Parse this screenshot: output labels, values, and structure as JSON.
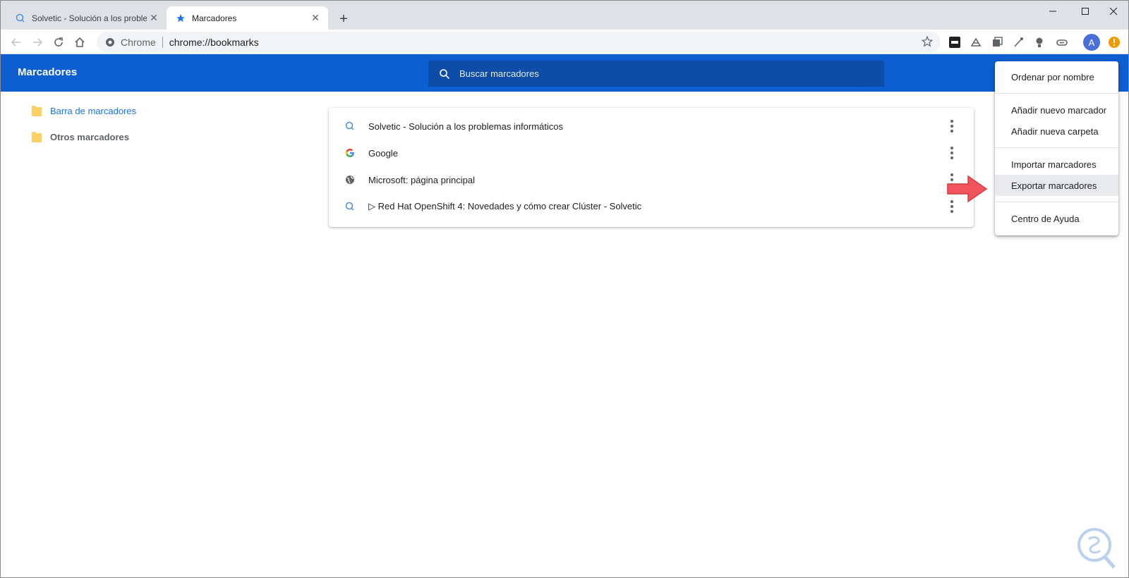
{
  "browser": {
    "tabs": [
      {
        "title": "Solvetic - Solución a los problemas",
        "icon": "solvetic-icon",
        "active": false
      },
      {
        "title": "Marcadores",
        "icon": "star-icon",
        "active": true
      }
    ],
    "new_tab": "+",
    "address": {
      "site_label": "Chrome",
      "url": "chrome://bookmarks"
    },
    "profile_initial": "A"
  },
  "app": {
    "title": "Marcadores",
    "search_placeholder": "Buscar marcadores",
    "accent": "#0d5ed0"
  },
  "sidebar": {
    "items": [
      {
        "label": "Barra de marcadores",
        "selected": true
      },
      {
        "label": "Otros marcadores",
        "selected": false
      }
    ]
  },
  "bookmarks": [
    {
      "title": "Solvetic - Solución a los problemas informáticos",
      "icon": "solvetic-icon"
    },
    {
      "title": "Google",
      "icon": "google-icon"
    },
    {
      "title": "Microsoft: página principal",
      "icon": "globe-icon"
    },
    {
      "title": "▷ Red Hat OpenShift 4: Novedades y cómo crear Clúster - Solvetic",
      "icon": "solvetic-icon"
    }
  ],
  "menu": {
    "items": [
      {
        "label": "Ordenar por nombre"
      },
      {
        "label": "Añadir nuevo marcador"
      },
      {
        "label": "Añadir nueva carpeta"
      },
      {
        "label": "Importar marcadores"
      },
      {
        "label": "Exportar marcadores",
        "highlighted": true
      },
      {
        "label": "Centro de Ayuda"
      }
    ]
  }
}
